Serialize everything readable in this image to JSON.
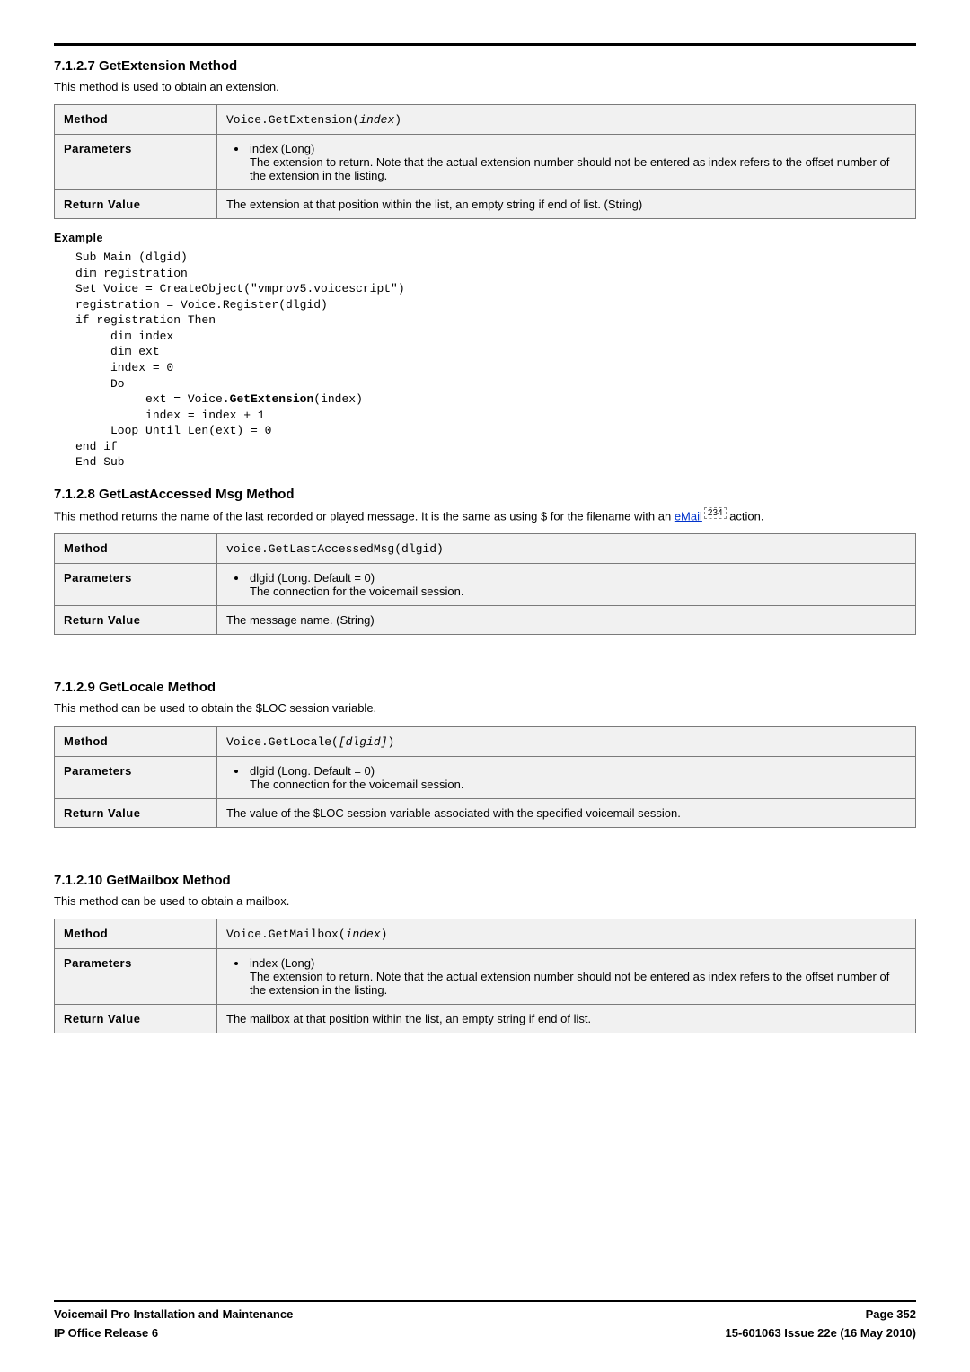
{
  "sections": {
    "s1": {
      "title": "7.1.2.7 GetExtension Method",
      "desc": "This method is used to obtain an extension.",
      "table": {
        "methodLabel": "Method",
        "methodCodePrefix": "Voice.GetExtension(",
        "methodCodeItalic": "index",
        "methodCodeSuffix": ")",
        "paramsLabel": "Parameters",
        "paramName": "index (Long)",
        "paramDesc": "The extension to return. Note that the actual extension number should not be entered as index refers to the offset number of the extension in the listing.",
        "returnLabel": "Return Value",
        "returnDesc": "The extension at that position within the list, an empty string if end of list. (String)"
      },
      "exampleLabel": "Example",
      "code": {
        "l1": "Sub Main (dlgid)",
        "l2": "dim registration",
        "l3": "Set Voice = CreateObject(\"vmprov5.voicescript\")",
        "l4": "registration = Voice.Register(dlgid)",
        "l5": "if registration Then",
        "l6": "     dim index",
        "l7": "     dim ext",
        "l8": "     index = 0",
        "l9": "     Do",
        "l10a": "          ext = Voice.",
        "l10b": "GetExtension",
        "l10c": "(index)",
        "l11": "          index = index + 1",
        "l12": "     Loop Until Len(ext) = 0",
        "l13": "end if",
        "l14": "End Sub"
      }
    },
    "s2": {
      "title": "7.1.2.8 GetLastAccessed Msg Method",
      "descPre": "This method returns the name of the last recorded or played message. It is the same as using $ for the filename with an ",
      "linkText": "eMail",
      "refBox": "234",
      "descPost": " action.",
      "table": {
        "methodLabel": "Method",
        "methodCode": "voice.GetLastAccessedMsg(dlgid)",
        "paramsLabel": "Parameters",
        "paramName": "dlgid (Long. Default = 0)",
        "paramDesc": "The connection for the voicemail session.",
        "returnLabel": "Return Value",
        "returnDesc": "The message name. (String)"
      }
    },
    "s3": {
      "title": "7.1.2.9 GetLocale Method",
      "desc": "This method can be used to obtain the $LOC session variable.",
      "table": {
        "methodLabel": "Method",
        "methodCodePrefix": "Voice.GetLocale(",
        "methodCodeItalic": "[dlgid]",
        "methodCodeSuffix": ")",
        "paramsLabel": "Parameters",
        "paramName": "dlgid (Long. Default = 0)",
        "paramDesc": "The connection for the voicemail session.",
        "returnLabel": "Return Value",
        "returnDesc": "The value of the $LOC session variable associated with the specified voicemail session."
      }
    },
    "s4": {
      "title": "7.1.2.10 GetMailbox Method",
      "desc": "This method can be used to obtain a mailbox.",
      "table": {
        "methodLabel": "Method",
        "methodCodePrefix": "Voice.GetMailbox(",
        "methodCodeItalic": "index",
        "methodCodeSuffix": ")",
        "paramsLabel": "Parameters",
        "paramName": "index (Long)",
        "paramDesc": "The extension to return. Note that the actual extension number should not be entered as index refers to the offset number of the extension in the listing.",
        "returnLabel": "Return Value",
        "returnDesc": "The mailbox at that position within the list, an empty string if end of list."
      }
    }
  },
  "footer": {
    "leftTop": "Voicemail Pro Installation and Maintenance",
    "rightTop": "Page 352",
    "leftBottom": "IP Office Release 6",
    "rightBottom": "15-601063 Issue 22e (16 May 2010)"
  }
}
